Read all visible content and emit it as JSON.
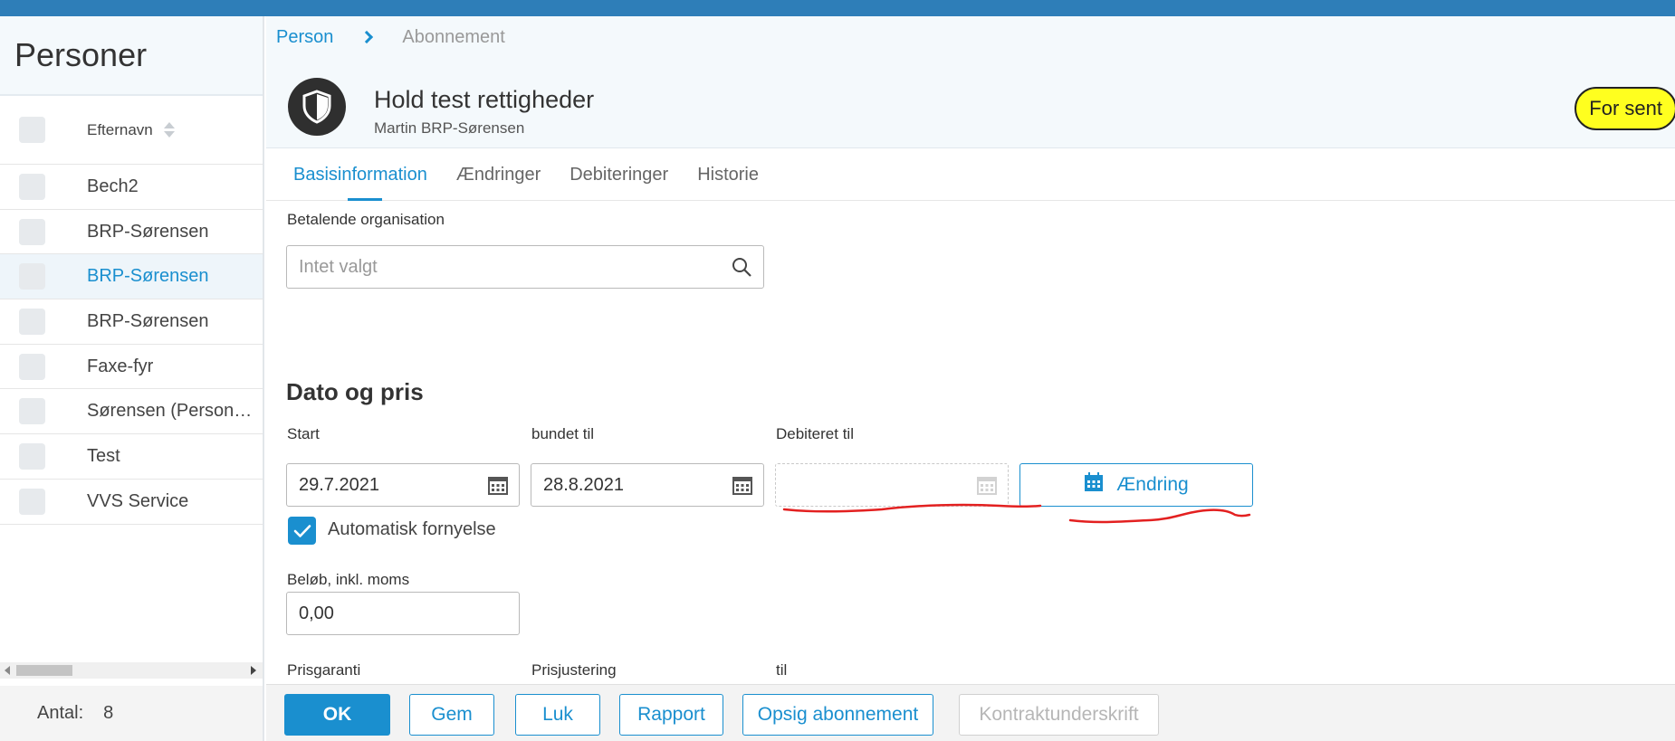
{
  "left_panel": {
    "title": "Personer",
    "column_header": "Efternavn",
    "rows": [
      {
        "label": "Bech2",
        "selected": false
      },
      {
        "label": "BRP-Sørensen",
        "selected": false
      },
      {
        "label": "BRP-Sørensen",
        "selected": true
      },
      {
        "label": "BRP-Sørensen",
        "selected": false
      },
      {
        "label": "Faxe-fyr",
        "selected": false
      },
      {
        "label": "Sørensen (Person…",
        "selected": false
      },
      {
        "label": "Test",
        "selected": false
      },
      {
        "label": "VVS Service",
        "selected": false
      }
    ],
    "count_label": "Antal:",
    "count_value": "8"
  },
  "breadcrumb": {
    "parent": "Person",
    "current": "Abonnement"
  },
  "header": {
    "title": "Hold test rettigheder",
    "subtitle": "Martin BRP-Sørensen",
    "status": "For sent",
    "status_color": "#ffff1f"
  },
  "tabs": [
    "Basisinformation",
    "Ændringer",
    "Debiteringer",
    "Historie"
  ],
  "form": {
    "org_label": "Betalende organisation",
    "org_placeholder": "Intet valgt",
    "section_title": "Dato og pris",
    "start_label": "Start",
    "start_value": "29.7.2021",
    "bound_label": "bundet til",
    "bound_value": "28.8.2021",
    "debited_label": "Debiteret til",
    "debited_value": "",
    "change_button": "Ændring",
    "auto_renew_label": "Automatisk fornyelse",
    "auto_renew_checked": true,
    "amount_label": "Beløb, inkl. moms",
    "amount_value": "0,00",
    "price_guarantee_label": "Prisgaranti",
    "price_adjust_label": "Prisjustering",
    "until_label": "til"
  },
  "footer_buttons": {
    "ok": "OK",
    "save": "Gem",
    "close": "Luk",
    "report": "Rapport",
    "cancel_subscription": "Opsig abonnement",
    "contract_signature": "Kontraktunderskrift"
  },
  "colors": {
    "accent": "#1a8fcf",
    "topbar": "#2e7eb8",
    "annotation": "#e32020"
  }
}
